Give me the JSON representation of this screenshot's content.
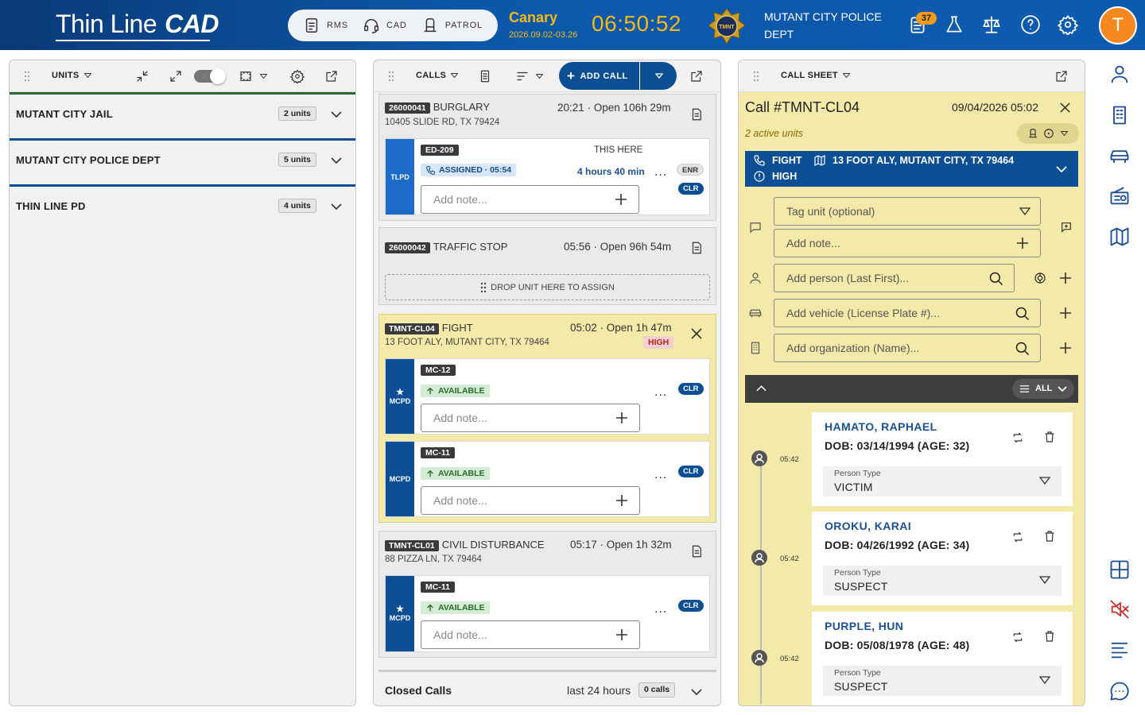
{
  "app": {
    "logo_text": "Thin Line",
    "logo_accent": "CAD",
    "modes": [
      {
        "label": "RMS",
        "icon": "clipboard-icon"
      },
      {
        "label": "CAD",
        "icon": "headset-icon"
      },
      {
        "label": "PATROL",
        "icon": "car-seat-icon"
      }
    ],
    "environment": {
      "name": "Canary",
      "version": "2026.09.02-03.26"
    },
    "clock": "06:50:52",
    "agency": "MUTANT CITY POLICE DEPT",
    "badge_text": "TMNT",
    "notification_count": "37",
    "user_initial": "T",
    "colors": {
      "brand": "#0d4f94",
      "accent": "#f5b91a",
      "avatar": "#f5891f",
      "selected_call": "#f3e9a8"
    }
  },
  "units_panel": {
    "title": "UNITS",
    "agencies": [
      {
        "name": "MUTANT CITY JAIL",
        "count": "2 units"
      },
      {
        "name": "MUTANT CITY POLICE DEPT",
        "count": "5 units"
      },
      {
        "name": "THIN LINE PD",
        "count": "4 units"
      }
    ]
  },
  "calls_panel": {
    "title": "CALLS",
    "add_call_label": "ADD CALL",
    "calls": [
      {
        "id": "26000041",
        "type": "BURGLARY",
        "time": "20:21 · Open 106h 29m",
        "address": "10405 SLIDE RD, TX 79424",
        "unit": {
          "agency": "TLPD",
          "id": "ED-209",
          "location": "THIS HERE",
          "status": "ASSIGNED · 05:54",
          "duration": "4 hours 40 min",
          "tags": [
            "ENR",
            "CLR"
          ],
          "note_placeholder": "Add note..."
        }
      },
      {
        "id": "26000042",
        "type": "TRAFFIC STOP",
        "time": "05:56 · Open 96h 54m",
        "drop_label": "DROP UNIT HERE TO ASSIGN"
      },
      {
        "id": "TMNT-CL04",
        "type": "FIGHT",
        "time": "05:02 · Open 1h 47m",
        "address": "13 FOOT ALY, MUTANT CITY, TX 79464",
        "priority": "HIGH",
        "units": [
          {
            "agency": "MCPD",
            "id": "MC-12",
            "status": "AVAILABLE",
            "tag": "CLR",
            "note_placeholder": "Add note..."
          },
          {
            "agency": "MCPD",
            "id": "MC-11",
            "status": "AVAILABLE",
            "tag": "CLR",
            "note_placeholder": "Add note..."
          }
        ]
      },
      {
        "id": "TMNT-CL01",
        "type": "CIVIL DISTURBANCE",
        "time": "05:17 · Open 1h 32m",
        "address": "88 PIZZA LN, TX 79464",
        "unit": {
          "agency": "MCPD",
          "id": "MC-11",
          "status": "AVAILABLE",
          "tag": "CLR",
          "note_placeholder": "Add note..."
        }
      }
    ],
    "closed": {
      "label": "Closed Calls",
      "range": "last 24 hours",
      "count": "0 calls"
    }
  },
  "call_sheet": {
    "title": "CALL SHEET",
    "call_number": "Call #TMNT-CL04",
    "datetime": "09/04/2026 05:02",
    "active_units": "2 active units",
    "banner": {
      "type": "FIGHT",
      "address": "13 FOOT ALY, MUTANT CITY, TX 79464",
      "priority": "HIGH"
    },
    "fields": {
      "tag_unit": "Tag unit (optional)",
      "note": "Add note...",
      "person": "Add person (Last First)...",
      "vehicle": "Add vehicle (License Plate #)...",
      "organization": "Add organization (Name)..."
    },
    "filter_label": "ALL",
    "people": [
      {
        "time": "05:42",
        "name": "HAMATO, RAPHAEL",
        "dob": "DOB: 03/14/1994 (AGE: 32)",
        "type_label": "Person Type",
        "type": "VICTIM"
      },
      {
        "time": "05:42",
        "name": "OROKU, KARAI",
        "dob": "DOB: 04/26/1992 (AGE: 34)",
        "type_label": "Person Type",
        "type": "SUSPECT"
      },
      {
        "time": "05:42",
        "name": "PURPLE, HUN",
        "dob": "DOB: 05/08/1978 (AGE: 48)",
        "type_label": "Person Type",
        "type": "SUSPECT"
      }
    ]
  }
}
